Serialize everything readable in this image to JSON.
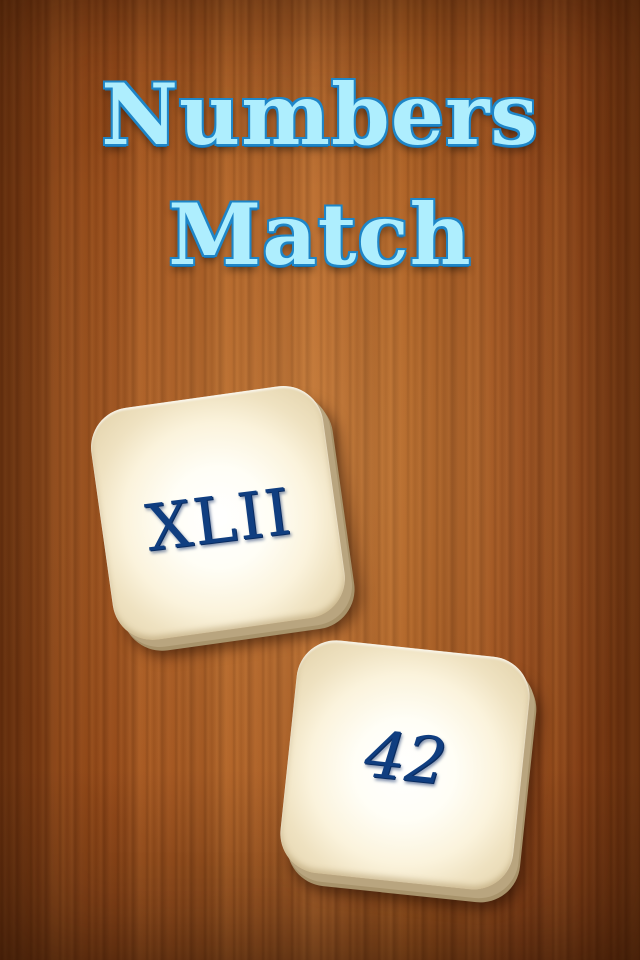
{
  "game": {
    "title_line_1": "Numbers",
    "title_line_2": "Match"
  },
  "tiles": [
    {
      "value": "XLII"
    },
    {
      "value": "42"
    }
  ]
}
